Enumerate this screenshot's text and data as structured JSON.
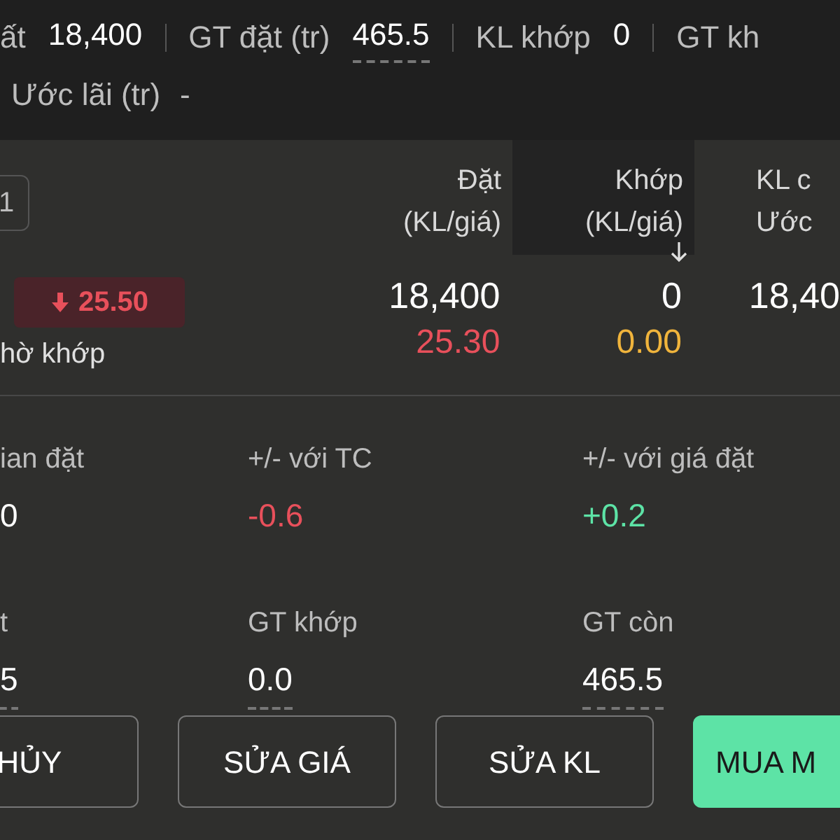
{
  "summary": {
    "row1": [
      {
        "label": "ất",
        "value": "18,400",
        "underlined": false
      },
      {
        "label": "GT đặt (tr)",
        "value": "465.5",
        "underlined": true
      },
      {
        "label": "KL khớp",
        "value": "0",
        "underlined": false
      },
      {
        "label": "GT kh"
      }
    ],
    "row2": {
      "label": "Ước lãi (tr)",
      "value": "-"
    }
  },
  "tab_chip": "1",
  "columns": [
    {
      "line1": "Đặt",
      "line2": "(KL/giá)",
      "sorted": false
    },
    {
      "line1": "Khớp",
      "line2": "(KL/giá)",
      "sorted": true
    },
    {
      "line1": "KL c",
      "line2": "Ước",
      "sorted": false
    }
  ],
  "order": {
    "price_badge": {
      "price": "25.50",
      "color": "#e8505b"
    },
    "status": "hờ khớp",
    "cells": [
      {
        "quantity": "18,400",
        "price": "25.30",
        "color": "#e8505b"
      },
      {
        "quantity": "0",
        "price": "0.00",
        "color": "#f0b43c"
      },
      {
        "quantity": "18,40"
      }
    ]
  },
  "details": [
    {
      "label": "ian đặt",
      "value": "0",
      "color": "#ffffff",
      "underlined": false
    },
    {
      "label": "+/- với TC",
      "value": "-0.6",
      "color": "#e8505b",
      "underlined": false
    },
    {
      "label": "+/- với giá đặt",
      "value": "+0.2",
      "color": "#5de3a6",
      "underlined": false
    },
    {
      "label": "t",
      "value": "5",
      "color": "#ffffff",
      "underlined": true
    },
    {
      "label": "GT khớp",
      "value": "0.0",
      "color": "#ffffff",
      "underlined": true
    },
    {
      "label": "GT còn",
      "value": "465.5",
      "color": "#ffffff",
      "underlined": true
    }
  ],
  "buttons": [
    {
      "label": "HỦY",
      "kind": "outline"
    },
    {
      "label": "SỬA GIÁ",
      "kind": "outline"
    },
    {
      "label": "SỬA KL",
      "kind": "outline"
    },
    {
      "label": "MUA M",
      "kind": "primary"
    }
  ]
}
